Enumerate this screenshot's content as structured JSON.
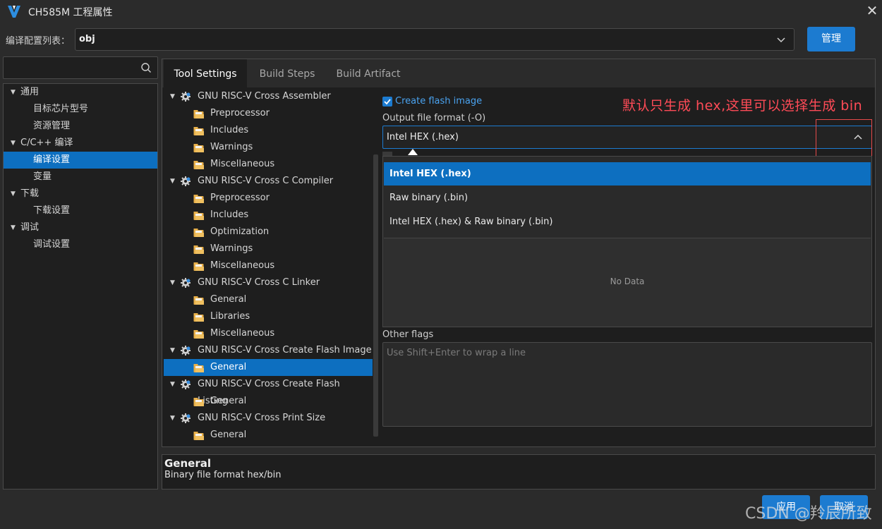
{
  "window": {
    "title": "CH585M 工程属性"
  },
  "config": {
    "label": "编译配置列表：",
    "value": "obj",
    "manage_label": "管理"
  },
  "left_tree": [
    {
      "label": "通用",
      "level": 0,
      "expanded": true
    },
    {
      "label": "目标芯片型号",
      "level": 1
    },
    {
      "label": "资源管理",
      "level": 1
    },
    {
      "label": "C/C++ 编译",
      "level": 0,
      "expanded": true
    },
    {
      "label": "编译设置",
      "level": 1,
      "selected": true
    },
    {
      "label": "变量",
      "level": 1
    },
    {
      "label": "下载",
      "level": 0,
      "expanded": true
    },
    {
      "label": "下载设置",
      "level": 1
    },
    {
      "label": "调试",
      "level": 0,
      "expanded": true
    },
    {
      "label": "调试设置",
      "level": 1
    }
  ],
  "tabs": [
    {
      "label": "Tool Settings",
      "active": true
    },
    {
      "label": "Build Steps"
    },
    {
      "label": "Build Artifact"
    }
  ],
  "tool_tree": [
    {
      "label": "GNU RISC-V Cross Assembler",
      "type": "category"
    },
    {
      "label": "Preprocessor",
      "type": "item"
    },
    {
      "label": "Includes",
      "type": "item"
    },
    {
      "label": "Warnings",
      "type": "item"
    },
    {
      "label": "Miscellaneous",
      "type": "item"
    },
    {
      "label": "GNU RISC-V Cross C Compiler",
      "type": "category"
    },
    {
      "label": "Preprocessor",
      "type": "item"
    },
    {
      "label": "Includes",
      "type": "item"
    },
    {
      "label": "Optimization",
      "type": "item"
    },
    {
      "label": "Warnings",
      "type": "item"
    },
    {
      "label": "Miscellaneous",
      "type": "item"
    },
    {
      "label": "GNU RISC-V Cross C Linker",
      "type": "category"
    },
    {
      "label": "General",
      "type": "item"
    },
    {
      "label": "Libraries",
      "type": "item"
    },
    {
      "label": "Miscellaneous",
      "type": "item"
    },
    {
      "label": "GNU RISC-V Cross Create Flash Image",
      "type": "category"
    },
    {
      "label": "General",
      "type": "item",
      "selected": true
    },
    {
      "label": "GNU RISC-V Cross Create Flash Listing",
      "type": "category"
    },
    {
      "label": "General",
      "type": "item"
    },
    {
      "label": "GNU RISC-V Cross Print Size",
      "type": "category"
    },
    {
      "label": "General",
      "type": "item"
    }
  ],
  "settings": {
    "create_flash_label": "Create flash image",
    "create_flash_checked": true,
    "format_label": "Output file format (-O)",
    "format_value": "Intel HEX (.hex)",
    "format_options": [
      {
        "label": "Intel HEX (.hex)",
        "selected": true
      },
      {
        "label": "Raw binary (.bin)"
      },
      {
        "label": "Intel HEX (.hex) & Raw binary (.bin)"
      }
    ],
    "no_data": "No Data",
    "other_flags_label": "Other flags",
    "other_flags_placeholder": "Use Shift+Enter to wrap a line",
    "annotation": "默认只生成 hex,这里可以选择生成 bin"
  },
  "description": {
    "title": "General",
    "text": "Binary file format hex/bin"
  },
  "buttons": {
    "apply": "应用",
    "cancel": "取消"
  },
  "watermark": "CSDN @羚辰所致",
  "colors": {
    "accent": "#1c7bd0",
    "selection": "#0d6fc0",
    "annotation": "#ff4b57"
  }
}
